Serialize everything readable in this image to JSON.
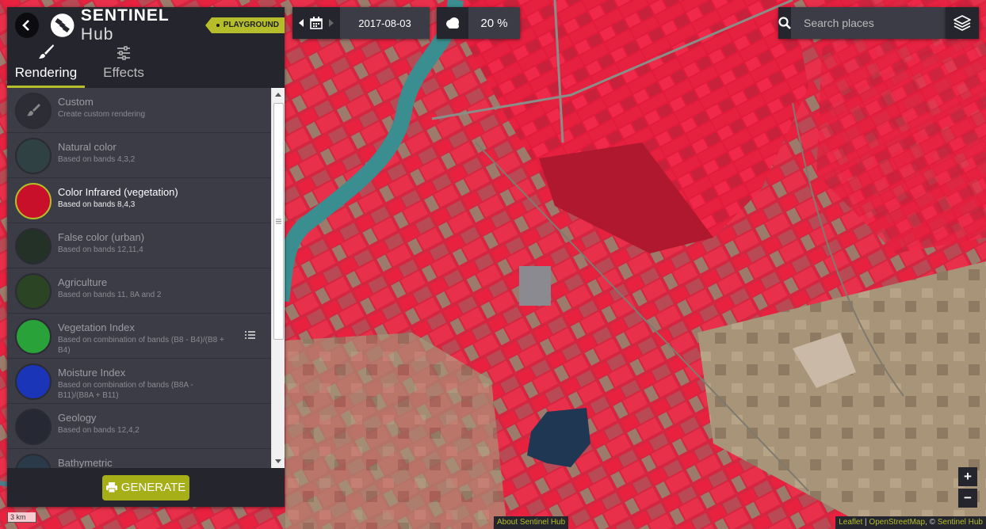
{
  "header": {
    "brand_bold": "SENTINEL",
    "brand_light": "Hub",
    "badge": "PLAYGROUND"
  },
  "tabs": [
    {
      "label": "Rendering",
      "active": true,
      "icon": "brush-icon"
    },
    {
      "label": "Effects",
      "active": false,
      "icon": "sliders-icon"
    }
  ],
  "layers": [
    {
      "title": "Custom",
      "subtitle": "Create custom rendering",
      "thumb_color": "#2c2d35",
      "active": false
    },
    {
      "title": "Natural color",
      "subtitle": "Based on bands 4,3,2",
      "thumb_color": "#2f4142",
      "active": false
    },
    {
      "title": "Color Infrared (vegetation)",
      "subtitle": "Based on bands 8,4,3",
      "thumb_color": "#c8102a",
      "active": true
    },
    {
      "title": "False color (urban)",
      "subtitle": "Based on bands 12,11,4",
      "thumb_color": "#233127",
      "active": false
    },
    {
      "title": "Agriculture",
      "subtitle": "Based on bands 11, 8A and 2",
      "thumb_color": "#2a4424",
      "active": false
    },
    {
      "title": "Vegetation Index",
      "subtitle": "Based on combination of bands (B8 - B4)/(B8 + B4)",
      "thumb_color": "#2aa23a",
      "active": false,
      "has_list_icon": true
    },
    {
      "title": "Moisture Index",
      "subtitle": "Based on combination of bands (B8A - B11)/(B8A + B11)",
      "thumb_color": "#1a35b8",
      "active": false
    },
    {
      "title": "Geology",
      "subtitle": "Based on bands 12,4,2",
      "thumb_color": "#262833",
      "active": false
    },
    {
      "title": "Bathymetric",
      "subtitle": "",
      "thumb_color": "#2a3a48",
      "active": false
    }
  ],
  "generate_label": "GENERATE",
  "date": "2017-08-03",
  "cloud": "20 %",
  "search_placeholder": "Search places",
  "zoom_in": "+",
  "zoom_out": "−",
  "scale": "3 km",
  "about": "About Sentinel Hub",
  "attribution": {
    "leaflet": "Leaflet",
    "sep1": " | ",
    "osm": "OpenStreetMap",
    "sep2": ", © ",
    "sh": "Sentinel Hub"
  },
  "colors": {
    "accent": "#b5bd2b",
    "panel_dark": "#25252d",
    "panel": "#3b3c46",
    "field_red": "#e8213f",
    "river": "#3a8e8f"
  }
}
